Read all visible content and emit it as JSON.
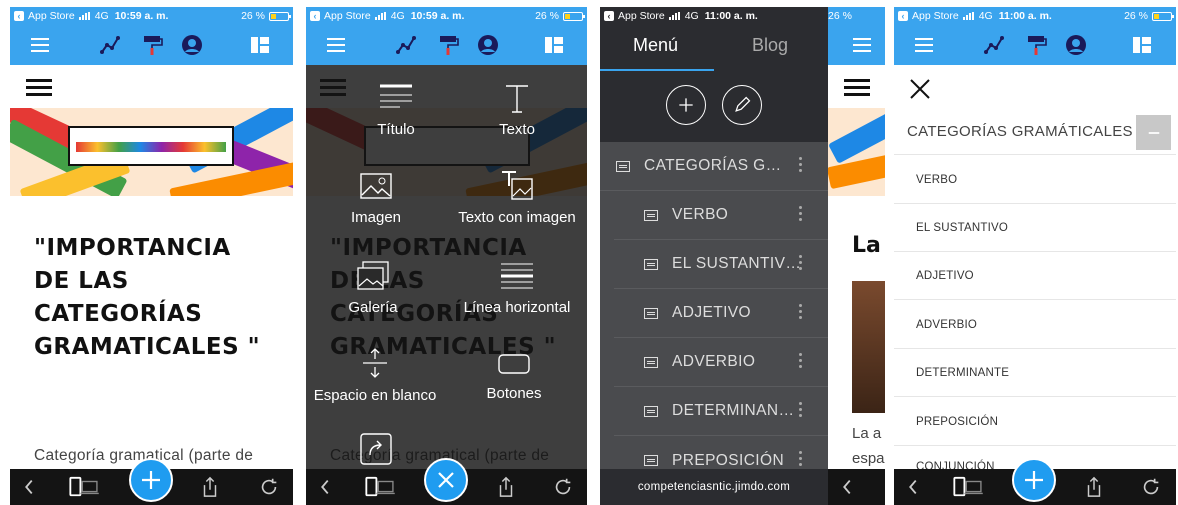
{
  "status": {
    "carrier": "App Store",
    "network": "4G",
    "battery": "26 %",
    "time_a": "10:59 a. m.",
    "time_b": "11:00 a. m.",
    "battery_partial": "26 %"
  },
  "page": {
    "headline": "\"IMPORTANCIA DE LAS CATEGORÍAS GRAMATICALES \"",
    "body_snippet": "Categoría gramatical (parte de"
  },
  "add_menu": {
    "options": [
      {
        "label": "Título",
        "icon": "title-icon"
      },
      {
        "label": "Texto",
        "icon": "text-icon"
      },
      {
        "label": "Imagen",
        "icon": "image-icon"
      },
      {
        "label": "Texto con imagen",
        "icon": "text-image-icon"
      },
      {
        "label": "Galería",
        "icon": "gallery-icon"
      },
      {
        "label": "Línea horizontal",
        "icon": "horizontal-line-icon"
      },
      {
        "label": "Espacio en blanco",
        "icon": "spacer-icon"
      },
      {
        "label": "Botones",
        "icon": "button-icon"
      }
    ]
  },
  "nav_menu": {
    "tab_menu": "Menú",
    "tab_blog": "Blog",
    "items": [
      "CATEGORÍAS G…",
      "VERBO",
      "EL SUSTANTIV…",
      "ADJETIVO",
      "ADVERBIO",
      "DETERMINAN…",
      "PREPOSICIÓN"
    ],
    "footer": "competenciasntic.jimdo.com"
  },
  "peek": {
    "heading": "La",
    "text1": "La a",
    "text2": "espa"
  },
  "submenu": {
    "title": "CATEGORÍAS GRAMÁTICALES",
    "items": [
      "VERBO",
      "EL SUSTANTIVO",
      "ADJETIVO",
      "ADVERBIO",
      "DETERMINANTE",
      "PREPOSICIÓN",
      "CONJUNCIÓN"
    ]
  },
  "colors": {
    "accent": "#3aa4ee",
    "fab": "#1f9cf0",
    "dark_bar": "#141414",
    "menu_bg": "#4a4b4e"
  }
}
